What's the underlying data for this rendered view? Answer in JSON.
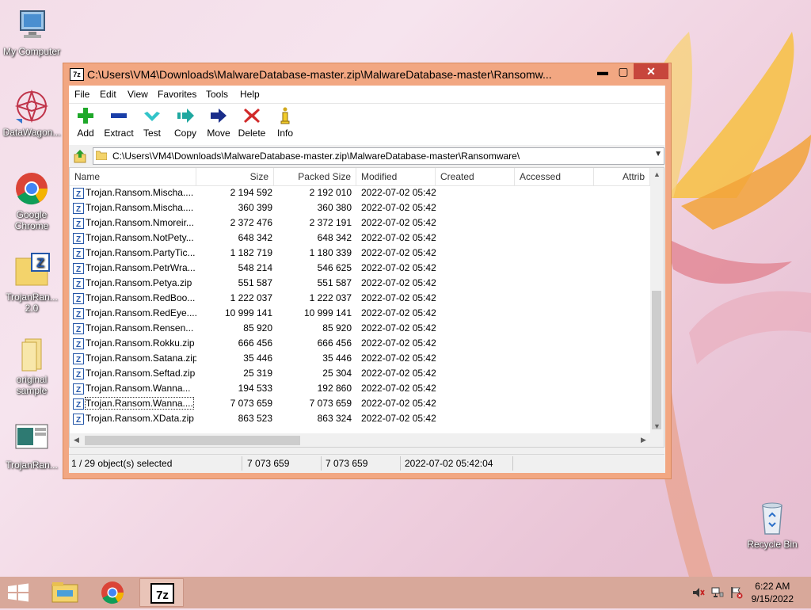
{
  "desktop": {
    "icons": [
      {
        "label": "My Computer"
      },
      {
        "label": "DataWagon..."
      },
      {
        "label": "Google Chrome"
      },
      {
        "label": "TrojanRan... 2.0"
      },
      {
        "label": "original sample"
      },
      {
        "label": "TrojanRan..."
      },
      {
        "label": "Recycle Bin"
      }
    ]
  },
  "window": {
    "title": "C:\\Users\\VM4\\Downloads\\MalwareDatabase-master.zip\\MalwareDatabase-master\\Ransomw...",
    "app_icon_text": "7z",
    "controls": {
      "minimize": "▬",
      "maximize": "▢",
      "close": "✕"
    },
    "menu": [
      "File",
      "Edit",
      "View",
      "Favorites",
      "Tools",
      "Help"
    ],
    "toolbar": [
      "Add",
      "Extract",
      "Test",
      "Copy",
      "Move",
      "Delete",
      "Info"
    ],
    "address": "C:\\Users\\VM4\\Downloads\\MalwareDatabase-master.zip\\MalwareDatabase-master\\Ransomware\\",
    "columns": [
      "Name",
      "Size",
      "Packed Size",
      "Modified",
      "Created",
      "Accessed",
      "Attrib"
    ],
    "rows": [
      {
        "name": "Trojan.Ransom.Mischa....",
        "size": "2 194 592",
        "packed": "2 192 010",
        "modified": "2022-07-02 05:42"
      },
      {
        "name": "Trojan.Ransom.Mischa....",
        "size": "360 399",
        "packed": "360 380",
        "modified": "2022-07-02 05:42"
      },
      {
        "name": "Trojan.Ransom.Nmoreir...",
        "size": "2 372 476",
        "packed": "2 372 191",
        "modified": "2022-07-02 05:42"
      },
      {
        "name": "Trojan.Ransom.NotPety...",
        "size": "648 342",
        "packed": "648 342",
        "modified": "2022-07-02 05:42"
      },
      {
        "name": "Trojan.Ransom.PartyTic...",
        "size": "1 182 719",
        "packed": "1 180 339",
        "modified": "2022-07-02 05:42"
      },
      {
        "name": "Trojan.Ransom.PetrWra...",
        "size": "548 214",
        "packed": "546 625",
        "modified": "2022-07-02 05:42"
      },
      {
        "name": "Trojan.Ransom.Petya.zip",
        "size": "551 587",
        "packed": "551 587",
        "modified": "2022-07-02 05:42"
      },
      {
        "name": "Trojan.Ransom.RedBoo...",
        "size": "1 222 037",
        "packed": "1 222 037",
        "modified": "2022-07-02 05:42"
      },
      {
        "name": "Trojan.Ransom.RedEye....",
        "size": "10 999 141",
        "packed": "10 999 141",
        "modified": "2022-07-02 05:42"
      },
      {
        "name": "Trojan.Ransom.Rensen...",
        "size": "85 920",
        "packed": "85 920",
        "modified": "2022-07-02 05:42"
      },
      {
        "name": "Trojan.Ransom.Rokku.zip",
        "size": "666 456",
        "packed": "666 456",
        "modified": "2022-07-02 05:42"
      },
      {
        "name": "Trojan.Ransom.Satana.zip",
        "size": "35 446",
        "packed": "35 446",
        "modified": "2022-07-02 05:42"
      },
      {
        "name": "Trojan.Ransom.Seftad.zip",
        "size": "25 319",
        "packed": "25 304",
        "modified": "2022-07-02 05:42"
      },
      {
        "name": "Trojan.Ransom.Wanna...",
        "size": "194 533",
        "packed": "192 860",
        "modified": "2022-07-02 05:42"
      },
      {
        "name": "Trojan.Ransom.Wanna....",
        "size": "7 073 659",
        "packed": "7 073 659",
        "modified": "2022-07-02 05:42",
        "selected": true
      },
      {
        "name": "Trojan.Ransom.XData.zip",
        "size": "863 523",
        "packed": "863 324",
        "modified": "2022-07-02 05:42"
      }
    ],
    "status": {
      "selection": "1 / 29 object(s) selected",
      "size": "7 073 659",
      "packed": "7 073 659",
      "modified": "2022-07-02 05:42:04"
    }
  },
  "taskbar": {
    "clock_time": "6:22 AM",
    "clock_date": "9/15/2022",
    "apps": [
      "file-explorer-icon",
      "chrome-icon",
      "7zip-icon"
    ]
  },
  "colors": {
    "window_frame": "#f2a782",
    "close_button": "#c7463c",
    "taskbar": "#d8a89a"
  }
}
